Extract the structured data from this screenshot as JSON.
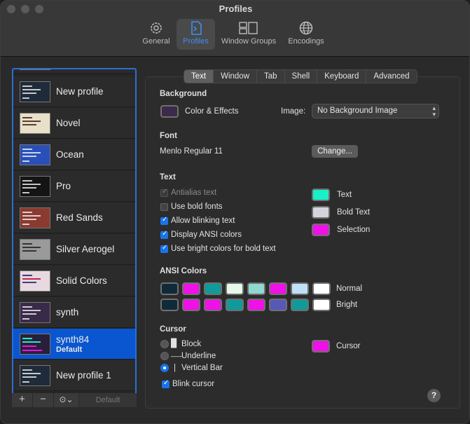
{
  "window": {
    "title": "Profiles"
  },
  "toolbar": {
    "items": [
      {
        "label": "General",
        "icon": "gear-icon"
      },
      {
        "label": "Profiles",
        "icon": "profiles-icon"
      },
      {
        "label": "Window Groups",
        "icon": "window-groups-icon"
      },
      {
        "label": "Encodings",
        "icon": "globe-icon"
      }
    ]
  },
  "sidebar": {
    "profiles": [
      {
        "name": "New profile",
        "default": ""
      },
      {
        "name": "Novel",
        "default": ""
      },
      {
        "name": "Ocean",
        "default": ""
      },
      {
        "name": "Pro",
        "default": ""
      },
      {
        "name": "Red Sands",
        "default": ""
      },
      {
        "name": "Silver Aerogel",
        "default": ""
      },
      {
        "name": "Solid Colors",
        "default": ""
      },
      {
        "name": "synth",
        "default": ""
      },
      {
        "name": "synth84",
        "default": "Default"
      },
      {
        "name": "New profile 1",
        "default": ""
      }
    ],
    "footer": {
      "add": "+",
      "remove": "−",
      "more": "⊙⌄",
      "default_label": "Default"
    }
  },
  "tabs": [
    "Text",
    "Window",
    "Tab",
    "Shell",
    "Keyboard",
    "Advanced"
  ],
  "background": {
    "header": "Background",
    "color_label": "Color & Effects",
    "color": "#3d2a4a",
    "image_label": "Image:",
    "image_value": "No Background Image"
  },
  "font": {
    "header": "Font",
    "value": "Menlo Regular 11",
    "change_label": "Change..."
  },
  "text": {
    "header": "Text",
    "options": [
      {
        "label": "Antialias text",
        "state": "disabled"
      },
      {
        "label": "Use bold fonts",
        "state": "off"
      },
      {
        "label": "Allow blinking text",
        "state": "on"
      },
      {
        "label": "Display ANSI colors",
        "state": "on"
      },
      {
        "label": "Use bright colors for bold text",
        "state": "on"
      }
    ],
    "colors": [
      {
        "label": "Text",
        "color": "#19f0c8"
      },
      {
        "label": "Bold Text",
        "color": "#d4d4dc"
      },
      {
        "label": "Selection",
        "color": "#f010e8"
      }
    ]
  },
  "ansi": {
    "header": "ANSI Colors",
    "normal_label": "Normal",
    "bright_label": "Bright",
    "normal": [
      "#102a3a",
      "#f010e8",
      "#109a9a",
      "#e8f8e8",
      "#90d8d0",
      "#f010e8",
      "#c0e0f8",
      "#ffffff"
    ],
    "bright": [
      "#102a3a",
      "#f010e8",
      "#f010e8",
      "#109a9a",
      "#f010e8",
      "#5858b8",
      "#109a9a",
      "#ffffff"
    ]
  },
  "cursor": {
    "header": "Cursor",
    "styles": [
      {
        "label": "Block",
        "glyph": "█",
        "selected": false
      },
      {
        "label": "Underline",
        "glyph": "___",
        "selected": false
      },
      {
        "label": "Vertical Bar",
        "glyph": "|",
        "selected": true
      }
    ],
    "color_label": "Cursor",
    "color": "#f010e8",
    "blink_label": "Blink cursor"
  },
  "help": {
    "label": "?"
  }
}
